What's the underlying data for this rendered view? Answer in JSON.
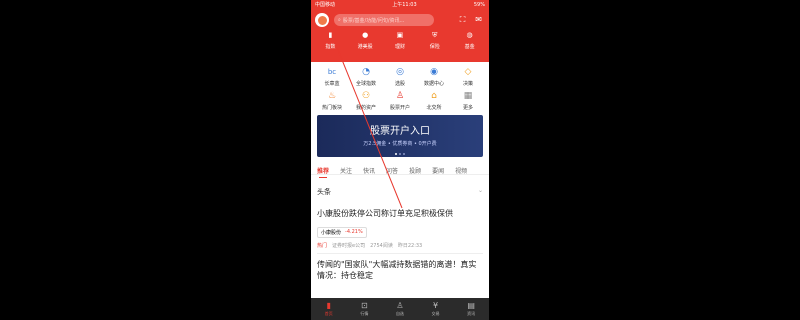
{
  "status": {
    "carrier": "中国移动",
    "time": "上午11:03",
    "battery": "59%"
  },
  "search": {
    "placeholder": "股票/基金/功能/问句/资讯..."
  },
  "quick": [
    {
      "label": "指数",
      "icon": "index-icon"
    },
    {
      "label": "港美股",
      "icon": "globe-icon"
    },
    {
      "label": "理财",
      "icon": "finance-icon"
    },
    {
      "label": "保险",
      "icon": "insurance-icon"
    },
    {
      "label": "基金",
      "icon": "fund-icon"
    }
  ],
  "grid": [
    {
      "label": "长章蓝",
      "icon": "bc",
      "color": "#3a7bd5"
    },
    {
      "label": "全球指数",
      "icon": "◔",
      "color": "#3a7bd5"
    },
    {
      "label": "选股",
      "icon": "◎",
      "color": "#3a7bd5"
    },
    {
      "label": "数据中心",
      "icon": "◉",
      "color": "#3a7bd5"
    },
    {
      "label": "决策",
      "icon": "◇",
      "color": "#f0a020"
    },
    {
      "label": "热门板块",
      "icon": "♨",
      "color": "#f07a20"
    },
    {
      "label": "我的资产",
      "icon": "⚇",
      "color": "#f0a020"
    },
    {
      "label": "股票开户",
      "icon": "♙",
      "color": "#e8392f"
    },
    {
      "label": "北交所",
      "icon": "⌂",
      "color": "#f0a020"
    },
    {
      "label": "更多",
      "icon": "▦",
      "color": "#888888"
    }
  ],
  "banner": {
    "title": "股票开户入口",
    "subtitle": "万2.5佣金 • 优质券商 • 0开户费"
  },
  "tabs": [
    "推荐",
    "关注",
    "快讯",
    "问答",
    "投顾",
    "要闻",
    "视频"
  ],
  "section": {
    "title": "头条"
  },
  "article1": {
    "headline": "小康股份跌停公司称订单充足积极保供",
    "stock": "小康股份",
    "change": "-4.21%",
    "hot": "热门",
    "source": "证券时报e公司",
    "reads": "2754阅读",
    "time": "昨日22:33"
  },
  "article2": {
    "headline": "传闻的\"国家队\"大幅减持数据错的离谱！真实情况：持仓稳定"
  },
  "nav": [
    "首页",
    "行情",
    "自选",
    "交易",
    "资讯"
  ],
  "colors": {
    "accent": "#e8392f",
    "banner": "#1b2a5a"
  }
}
